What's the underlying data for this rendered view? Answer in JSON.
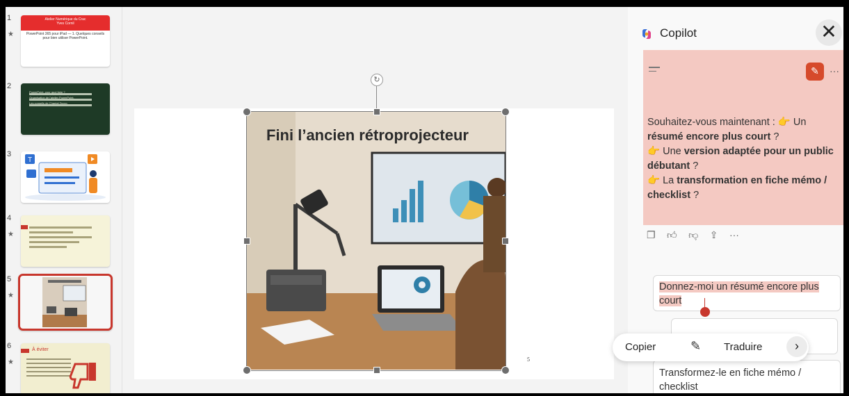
{
  "thumbnails": [
    {
      "num": "1",
      "star": "★",
      "title_lines": [
        "Atelier Numérique du Crac",
        "Yves Cornil"
      ],
      "body": "PowerPoint 365 pour iPad — 1. Quelques conseils pour bien utiliser PowerPoint."
    },
    {
      "num": "2",
      "star": "",
      "lines": [
        "PowerPoint, pour quoi faire ?",
        "Organisation de l'atelier PowerPoint.",
        "Les conseils de Chantal Zucco."
      ]
    },
    {
      "num": "3",
      "star": ""
    },
    {
      "num": "4",
      "star": "★"
    },
    {
      "num": "5",
      "star": "★"
    },
    {
      "num": "6",
      "star": "★",
      "heading": "À éviter"
    }
  ],
  "slide": {
    "image_title": "Fini l’ancien rétroprojecteur",
    "page_number": "5",
    "rotate_icon": "rotate-icon"
  },
  "copilot": {
    "title": "Copilot",
    "close_label": "✕",
    "edit_icon": "edit-icon",
    "more_label": "···",
    "reply": {
      "intro": "Souhaitez-vous maintenant :",
      "opt1_pre": "Un",
      "opt1_bold": "résumé encore plus court",
      "opt1_post": "?",
      "opt2_pre": "Une",
      "opt2_bold": "version adaptée pour un public débutant",
      "opt2_post": "?",
      "opt3_pre": "La",
      "opt3_bold": "transformation en fiche mémo / checklist",
      "opt3_post": "?"
    },
    "actions": [
      "copy-icon",
      "thumbs-up-icon",
      "thumbs-down-icon",
      "share-icon",
      "more-icon"
    ],
    "suggestions": [
      "Donnez-moi un résumé encore plus court",
      "Transformez-le en fiche mémo / checklist"
    ]
  },
  "context_menu": {
    "copy": "Copier",
    "translate": "Traduire",
    "next": "›"
  },
  "colors": {
    "accent_red": "#c8372d",
    "highlight_pink": "#f4c9c2",
    "hand_orange": "#e89a2c"
  }
}
